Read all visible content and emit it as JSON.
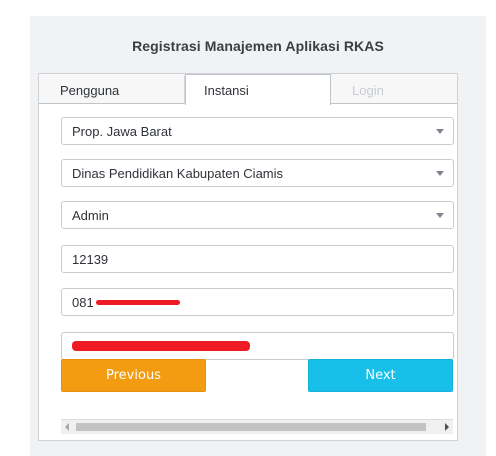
{
  "header": {
    "title": "Registrasi Manajemen Aplikasi RKAS"
  },
  "tabs": [
    {
      "label": "Pengguna",
      "state": "inactive"
    },
    {
      "label": "Instansi",
      "state": "active"
    },
    {
      "label": "Login",
      "state": "disabled"
    }
  ],
  "form": {
    "province_select": "Prop. Jawa Barat",
    "agency_select": "Dinas Pendidikan Kabupaten Ciamis",
    "role_select": "Admin",
    "code_value": "12139",
    "phone_value_prefix": "081"
  },
  "buttons": {
    "previous_label": "Previous",
    "next_label": "Next"
  },
  "colors": {
    "previous": "#f39c12",
    "next": "#18bfe8",
    "redaction": "#ee1b24"
  },
  "icons": [
    "chevron-down-icon",
    "scroll-left-arrow-icon",
    "scroll-right-arrow-icon"
  ]
}
